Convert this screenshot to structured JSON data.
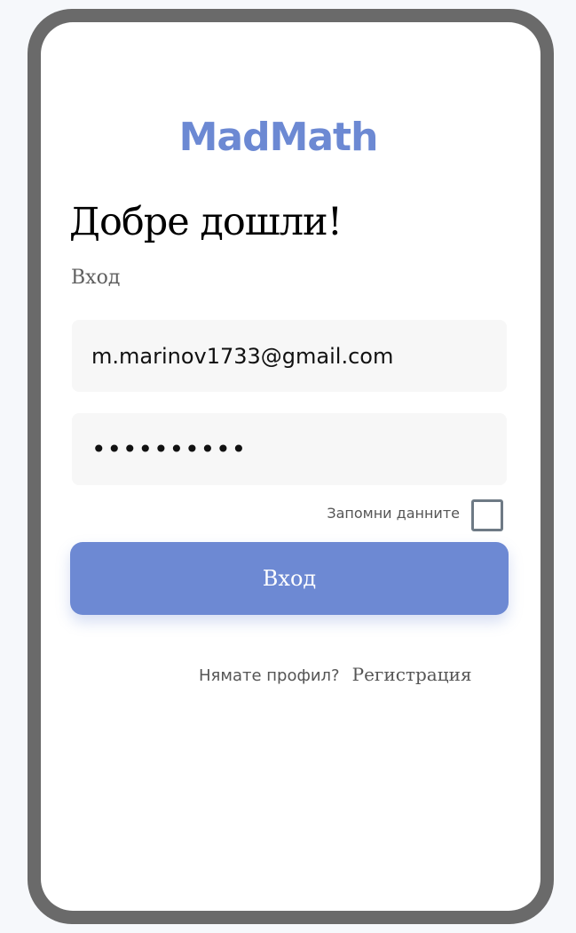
{
  "app": {
    "brand": "MadMath"
  },
  "login": {
    "welcome_title": "Добре дошли!",
    "subtitle": "Вход",
    "email_value": "m.marinov1733@gmail.com",
    "password_value": "mmmmmmmmmm",
    "remember_label": "Запомни данните",
    "remember_checked": false,
    "submit_label": "Вход",
    "no_account_prompt": "Нямате профил?",
    "register_link": "Регистрация"
  },
  "colors": {
    "accent": "#6d89d3",
    "frame": "#6a6a6a",
    "field_background": "#f7f7f7"
  }
}
